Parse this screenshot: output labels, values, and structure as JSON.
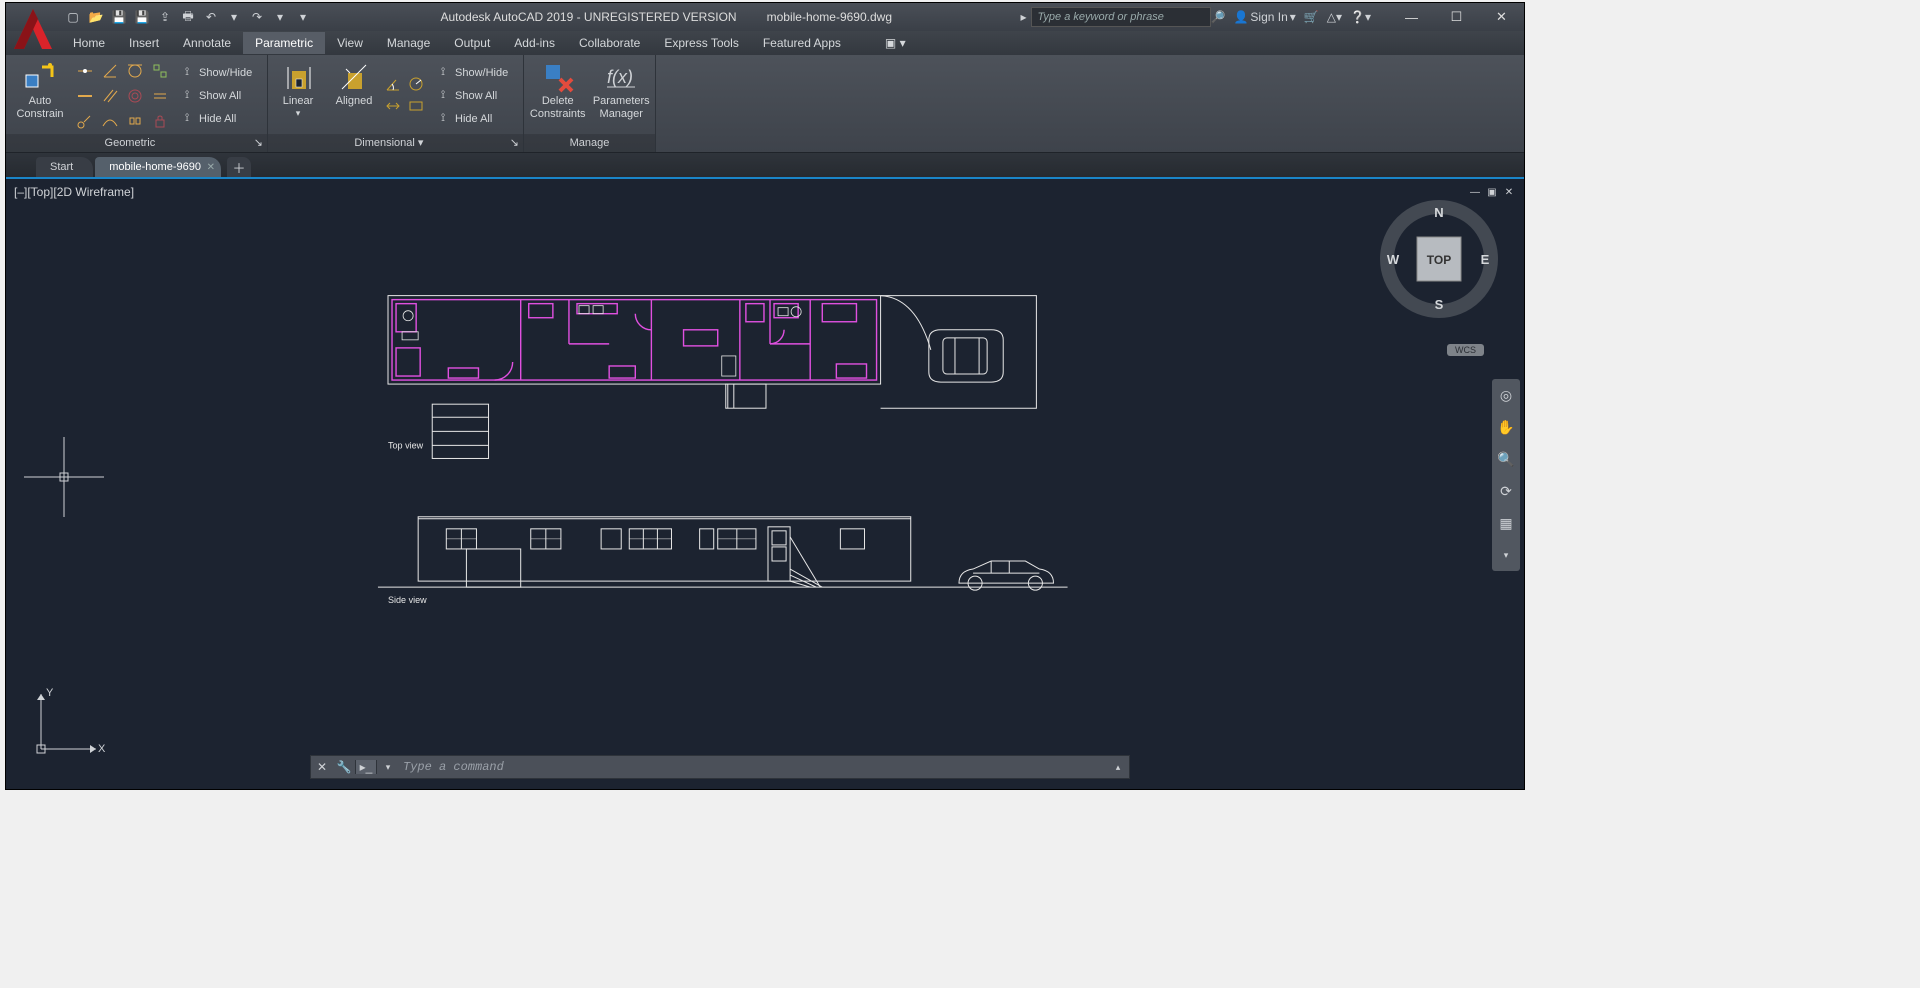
{
  "title": {
    "app": "Autodesk AutoCAD 2019 - UNREGISTERED VERSION",
    "file": "mobile-home-9690.dwg"
  },
  "search": {
    "placeholder": "Type a keyword or phrase"
  },
  "signin": "Sign In",
  "menus": [
    "Home",
    "Insert",
    "Annotate",
    "Parametric",
    "View",
    "Manage",
    "Output",
    "Add-ins",
    "Collaborate",
    "Express Tools",
    "Featured Apps"
  ],
  "active_menu": "Parametric",
  "ribbon": {
    "panels": [
      "Geometric",
      "Dimensional ▾",
      "Manage"
    ],
    "autoconstrain": "Auto\nConstrain",
    "showhide": "Show/Hide",
    "showall": "Show All",
    "hideall": "Hide All",
    "linear": "Linear",
    "aligned": "Aligned",
    "delete": "Delete\nConstraints",
    "params": "Parameters\nManager"
  },
  "filetabs": {
    "start": "Start",
    "doc": "mobile-home-9690"
  },
  "vp": {
    "label": "[–][Top][2D Wireframe]"
  },
  "viewcube": {
    "face": "TOP",
    "n": "N",
    "e": "E",
    "s": "S",
    "w": "W"
  },
  "wcs": "WCS",
  "ucs": {
    "x": "X",
    "y": "Y"
  },
  "cmd": {
    "placeholder": "Type a command"
  },
  "drawing_labels": {
    "top": "Top view",
    "side": "Side view"
  }
}
